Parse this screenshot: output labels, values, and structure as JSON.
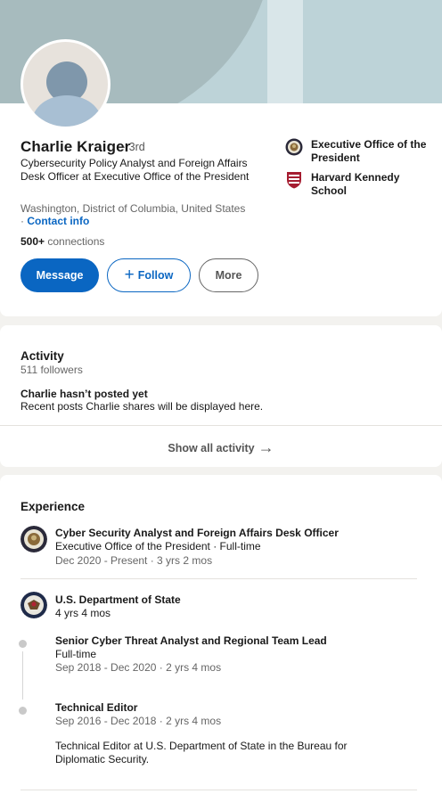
{
  "profile": {
    "name": "Charlie Kraiger",
    "degree": "· 3rd",
    "headline": "Cybersecurity Policy Analyst and Foreign Affairs Desk Officer at Executive Office of the President",
    "location": "Washington, District of Columbia, United States",
    "contact_prefix": "· ",
    "contact_label": "Contact info",
    "connections_count": "500+",
    "connections_label": " connections",
    "orgs": [
      {
        "label": "Executive Office of the President",
        "icon": "presidential-seal-icon"
      },
      {
        "label": "Harvard Kennedy School",
        "icon": "harvard-shield-icon"
      }
    ],
    "buttons": {
      "message": "Message",
      "follow": "Follow",
      "follow_icon": "+",
      "more": "More"
    }
  },
  "activity": {
    "title": "Activity",
    "followers": "511 followers",
    "empty_title": "Charlie hasn’t posted yet",
    "empty_sub": "Recent posts Charlie shares will be displayed here.",
    "show_all": "Show all activity",
    "show_all_icon": "→"
  },
  "experience": {
    "title": "Experience",
    "items": [
      {
        "title": "Cyber Security Analyst and Foreign Affairs Desk Officer",
        "company": "Executive Office of the President · Full-time",
        "dates": "Dec 2020 - Present · 3 yrs 2 mos",
        "icon": "presidential-seal-icon"
      },
      {
        "company": "U.S. Department of State",
        "duration": "4 yrs 4 mos",
        "icon": "state-department-seal-icon",
        "roles": [
          {
            "title": "Senior Cyber Threat Analyst and Regional Team Lead",
            "type": "Full-time",
            "dates": "Sep 2018 - Dec 2020 · 2 yrs 4 mos"
          },
          {
            "title": "Technical Editor",
            "dates": "Sep 2016 - Dec 2018 · 2 yrs 4 mos",
            "description": "Technical Editor at U.S. Department of State in the Bureau for Diplomatic Security."
          }
        ]
      }
    ]
  },
  "colors": {
    "accent": "#0a66c2",
    "banner": "#bdd3d8",
    "banner_arc": "#a7bbbe",
    "page_bg": "#f3f2ef"
  }
}
